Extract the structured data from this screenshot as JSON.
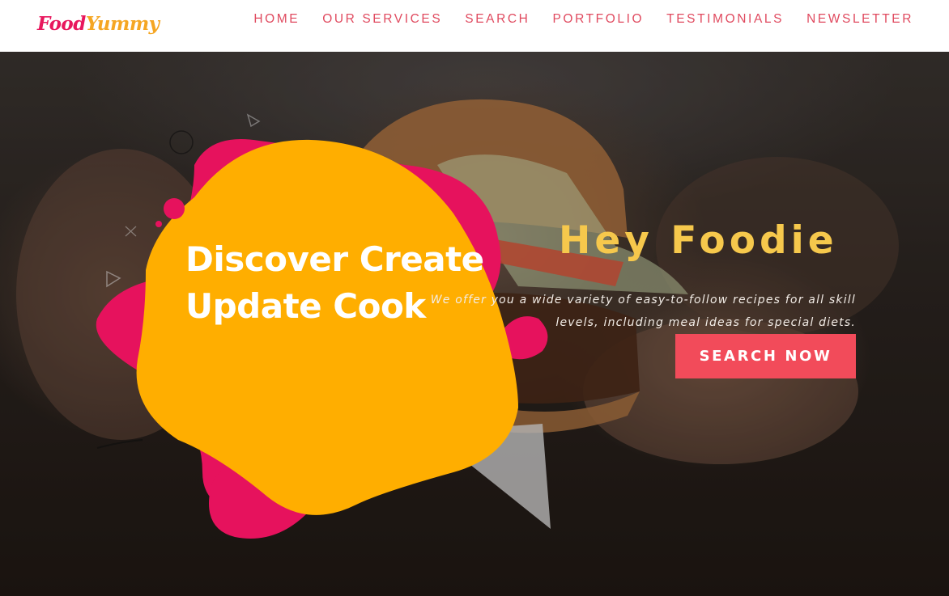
{
  "logo": {
    "part1": "Food",
    "part2": "Yummy"
  },
  "nav": {
    "items": [
      {
        "label": "HOME"
      },
      {
        "label": "OUR SERVICES"
      },
      {
        "label": "SEARCH"
      },
      {
        "label": "PORTFOLIO"
      },
      {
        "label": "TESTIMONIALS"
      },
      {
        "label": "NEWSLETTER"
      }
    ]
  },
  "hero": {
    "title_line1": "Discover Create",
    "title_line2": "Update Cook",
    "heading": "Hey Foodie",
    "tagline": "We offer you a wide variety of easy-to-follow recipes for all skill levels, including meal ideas for special diets.",
    "button_label": "SEARCH NOW"
  },
  "colors": {
    "accent": "#f24b5a",
    "brand_pink": "#e8175d",
    "brand_yellow": "#ffae00",
    "heading_yellow": "#f6c84c",
    "nav_text": "#e04a5f"
  }
}
